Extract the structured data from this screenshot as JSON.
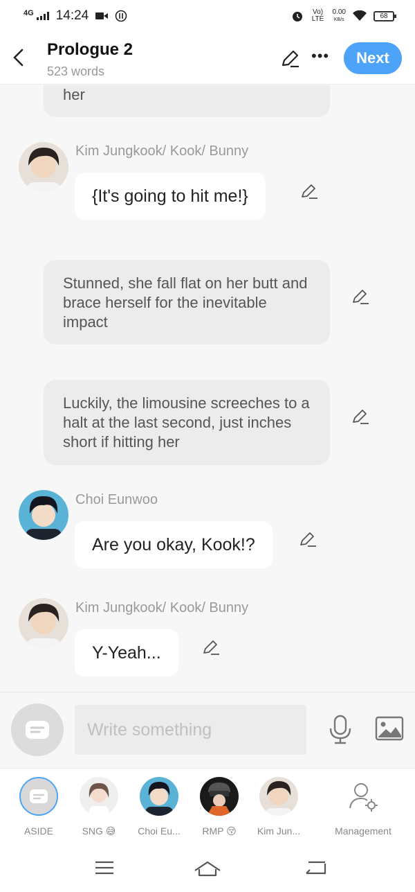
{
  "status": {
    "network": "4G",
    "time": "14:24",
    "volte": "Vo) LTE",
    "speed": "0.00",
    "speed_unit": "KB/s",
    "battery": "68"
  },
  "header": {
    "title": "Prologue 2",
    "word_count": "523 words",
    "next_label": "Next"
  },
  "chat": {
    "top_aside": "her",
    "msg1": {
      "speaker": "Kim Jungkook/ Kook/ Bunny",
      "text": "{It's going to hit me!}"
    },
    "aside1": "Stunned, she fall flat on her butt and brace herself for the inevitable impact",
    "aside2": "Luckily, the limousine screeches to a halt at the last second, just inches short if hitting her",
    "msg2": {
      "speaker": "Choi Eunwoo",
      "text": "Are you okay, Kook!?"
    },
    "msg3": {
      "speaker": "Kim Jungkook/ Kook/ Bunny",
      "text": "Y-Yeah..."
    }
  },
  "input": {
    "placeholder": "Write something"
  },
  "characters": [
    {
      "label": "ASIDE"
    },
    {
      "label": "SNG 😅"
    },
    {
      "label": "Choi Eu..."
    },
    {
      "label": "RMP 😚"
    },
    {
      "label": "Kim Jun..."
    },
    {
      "label": "Management"
    }
  ],
  "colors": {
    "accent": "#4da3f7",
    "aside_bubble": "#ececec",
    "background": "#f7f7f7"
  }
}
